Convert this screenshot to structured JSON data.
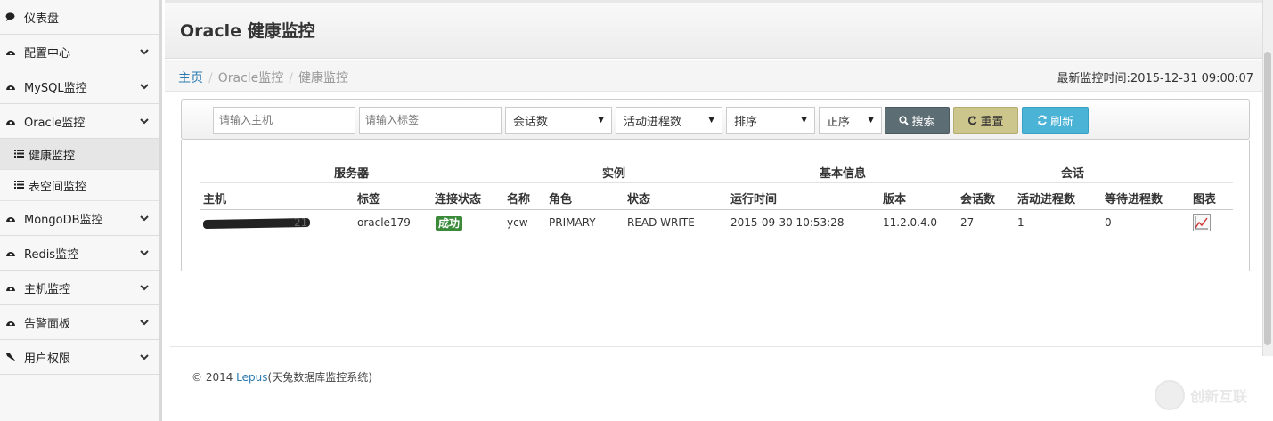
{
  "sidebar": {
    "items": [
      {
        "label": "仪表盘",
        "icon": "comment-icon",
        "chevron": false
      },
      {
        "label": "配置中心",
        "icon": "dashboard-icon",
        "chevron": true
      },
      {
        "label": "MySQL监控",
        "icon": "dashboard-icon",
        "chevron": true
      },
      {
        "label": "Oracle监控",
        "icon": "dashboard-icon",
        "chevron": true
      },
      {
        "label": "MongoDB监控",
        "icon": "dashboard-icon",
        "chevron": true
      },
      {
        "label": "Redis监控",
        "icon": "dashboard-icon",
        "chevron": true
      },
      {
        "label": "主机监控",
        "icon": "dashboard-icon",
        "chevron": true
      },
      {
        "label": "告警面板",
        "icon": "dashboard-icon",
        "chevron": true
      },
      {
        "label": "用户权限",
        "icon": "wrench-icon",
        "chevron": true
      }
    ],
    "sub_items": [
      {
        "label": "健康监控",
        "icon": "list-icon",
        "active": true
      },
      {
        "label": "表空间监控",
        "icon": "list-icon",
        "active": false
      }
    ]
  },
  "header": {
    "title": "Oracle 健康监控"
  },
  "breadcrumb": {
    "home": "主页",
    "level2": "Oracle监控",
    "current": "健康监控",
    "sep": "/"
  },
  "last_time": "最新监控时间:2015-12-31 09:00:07",
  "filters": {
    "host_placeholder": "请输入主机",
    "tag_placeholder": "请输入标签",
    "select_sessions": "会话数",
    "select_active": "活动进程数",
    "select_sort": "排序",
    "select_order": "正序",
    "search_label": "搜索",
    "reset_label": "重置",
    "refresh_label": "刷新"
  },
  "table": {
    "groups": [
      "服务器",
      "实例",
      "基本信息",
      "会话"
    ],
    "columns": [
      "主机",
      "标签",
      "连接状态",
      "名称",
      "角色",
      "状态",
      "运行时间",
      "版本",
      "会话数",
      "活动进程数",
      "等待进程数",
      "图表"
    ],
    "rows": [
      {
        "host_suffix": "21",
        "tag": "oracle179",
        "conn_status": "成功",
        "name": "ycw",
        "role": "PRIMARY",
        "state": "READ WRITE",
        "uptime": "2015-09-30 10:53:28",
        "version": "11.2.0.4.0",
        "sessions": "27",
        "active": "1",
        "waiting": "0"
      }
    ]
  },
  "footer": {
    "prefix": "© 2014 ",
    "brand": "Lepus",
    "suffix": "(天兔数据库监控系统)"
  },
  "watermark": "创新互联",
  "colors": {
    "link": "#2a7ab0",
    "badge_success": "#3a8a3a",
    "btn_search": "#5d6d74",
    "btn_reset": "#cdc68c",
    "btn_refresh": "#4bb3d6"
  }
}
